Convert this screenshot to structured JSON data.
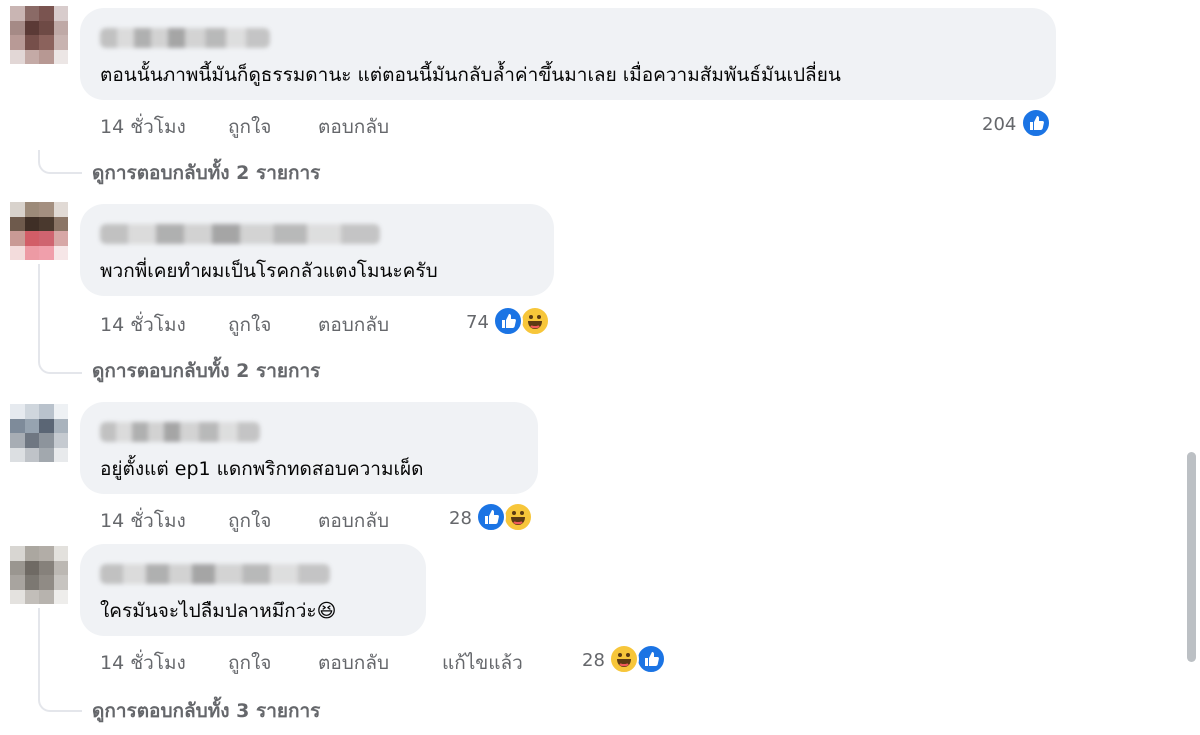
{
  "comments": [
    {
      "text": "ตอนนั้นภาพนี้มันก็ดูธรรมดานะ แต่ตอนนี้มันกลับล้ำค่าขึ้นมาเลย เมื่อความสัมพันธ์มันเปลี่ยน",
      "time": "14 ชั่วโมง",
      "like_label": "ถูกใจ",
      "reply_label": "ตอบกลับ",
      "reaction_count": "204",
      "reactions": [
        "like-icon"
      ],
      "view_replies": "ดูการตอบกลับทั้ง 2 รายการ"
    },
    {
      "text": "พวกพี่เคยทำผมเป็นโรคกลัวแตงโมนะครับ",
      "time": "14 ชั่วโมง",
      "like_label": "ถูกใจ",
      "reply_label": "ตอบกลับ",
      "reaction_count": "74",
      "reactions": [
        "like-icon",
        "haha-icon"
      ],
      "view_replies": "ดูการตอบกลับทั้ง 2 รายการ"
    },
    {
      "text": "อยู่ตั้งแต่ ep1 แดกพริกทดสอบความเผ็ด",
      "time": "14 ชั่วโมง",
      "like_label": "ถูกใจ",
      "reply_label": "ตอบกลับ",
      "reaction_count": "28",
      "reactions": [
        "like-icon",
        "haha-icon"
      ]
    },
    {
      "text": "ใครมันจะไปลืมปลาหมึกว่ะ",
      "emoji": "😆",
      "time": "14 ชั่วโมง",
      "like_label": "ถูกใจ",
      "reply_label": "ตอบกลับ",
      "edited_label": "แก้ไขแล้ว",
      "reaction_count": "28",
      "reactions": [
        "haha-icon",
        "like-icon"
      ],
      "view_replies": "ดูการตอบกลับทั้ง 3 รายการ"
    }
  ],
  "colors": {
    "bubble": "#f0f2f5",
    "like_blue": "#1b74e4",
    "haha_yellow": "#f7c63a",
    "meta_gray": "#65676b"
  }
}
